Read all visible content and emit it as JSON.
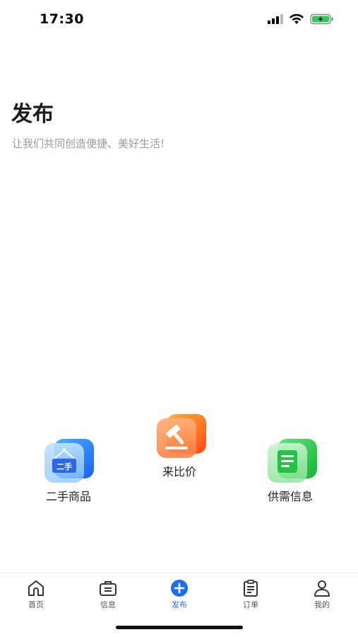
{
  "status_bar": {
    "time": "17:30",
    "icons": [
      "signal-icon",
      "wifi-icon",
      "battery-charging-icon"
    ]
  },
  "header": {
    "title": "发布",
    "subtitle": "让我们共同创造便捷、美好生活!"
  },
  "actions": [
    {
      "label": "二手商品",
      "icon": "second-hand-sign-icon",
      "badge_text": "二手",
      "color": "#2f7cf6"
    },
    {
      "label": "来比价",
      "icon": "auction-hammer-icon",
      "color": "#ff6a1a"
    },
    {
      "label": "供需信息",
      "icon": "document-list-icon",
      "color": "#2fc94a"
    }
  ],
  "tabbar": {
    "items": [
      {
        "label": "首页",
        "icon": "home-icon",
        "active": false
      },
      {
        "label": "信息",
        "icon": "info-bag-icon",
        "active": false
      },
      {
        "label": "发布",
        "icon": "plus-circle-icon",
        "active": true
      },
      {
        "label": "订单",
        "icon": "clipboard-icon",
        "active": false
      },
      {
        "label": "我的",
        "icon": "user-icon",
        "active": false
      }
    ],
    "active_color": "#1e6ef5",
    "inactive_color": "#555555"
  }
}
